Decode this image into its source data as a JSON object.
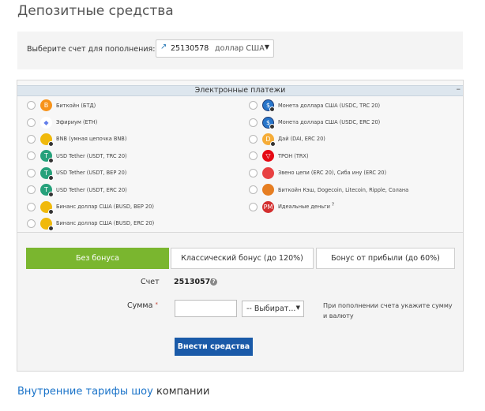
{
  "page": {
    "title": "Депозитные средства"
  },
  "account": {
    "label": "Выберите счет для пополнения:",
    "number": "25130578",
    "currency": "доллар США"
  },
  "payments": {
    "header": "Электронные платежи",
    "left": [
      {
        "label": "Биткойн (БТД)",
        "icon": "bitcoin-icon",
        "color": "#f7931a",
        "glyph": "B"
      },
      {
        "label": "Эфириум (ETH)",
        "icon": "ethereum-icon",
        "color": "#ffffff",
        "glyph": ""
      },
      {
        "label": "BNB (умная цепочка BNB)",
        "icon": "bnb-icon",
        "color": "#f0b90b",
        "glyph": ""
      },
      {
        "label": "USD Tether (USDT, TRC 20)",
        "icon": "tether-icon",
        "color": "#26a17b",
        "glyph": "T"
      },
      {
        "label": "USD Tether (USDT, BEP 20)",
        "icon": "tether-icon",
        "color": "#26a17b",
        "glyph": "T"
      },
      {
        "label": "USD Tether (USDT, ERC 20)",
        "icon": "tether-icon",
        "color": "#26a17b",
        "glyph": "T"
      },
      {
        "label": "Бинанс доллар США (BUSD, BEP 20)",
        "icon": "busd-icon",
        "color": "#f0b90b",
        "glyph": ""
      },
      {
        "label": "Бинанс доллар США (BUSD, ERC 20)",
        "icon": "busd-icon",
        "color": "#f0b90b",
        "glyph": ""
      }
    ],
    "right": [
      {
        "label": "Монета доллара США (USDC, TRC 20)",
        "icon": "usdc-icon",
        "color": "#2775ca",
        "glyph": "$"
      },
      {
        "label": "Монета доллара США (USDC, ERC 20)",
        "icon": "usdc-icon",
        "color": "#2775ca",
        "glyph": "$"
      },
      {
        "label": "Дай (DAI, ERC 20)",
        "icon": "dai-icon",
        "color": "#f5ac37",
        "glyph": "D"
      },
      {
        "label": "ТРОН (TRX)",
        "icon": "tron-icon",
        "color": "#e50914",
        "glyph": "▽"
      },
      {
        "label": "Звено цепи (ERC 20), Сиба ину (ERC 20)",
        "icon": "chainlink-icon",
        "color": "#e84142",
        "glyph": ""
      },
      {
        "label": "Биткойн Кэш, Dogecoin, Litecoin, Ripple, Солана",
        "icon": "altcoins-icon",
        "color": "#e67e22",
        "glyph": ""
      },
      {
        "label": "Идеальные деньги",
        "icon": "perfect-money-icon",
        "color": "#d32f2f",
        "glyph": "PM",
        "sup": "?"
      }
    ]
  },
  "bonus": {
    "options": [
      "Без бонуса",
      "Классический бонус (до 120%)",
      "Бонус от прибыли (до 60%)"
    ]
  },
  "form": {
    "account_label": "Счет",
    "account_value": "25130578",
    "amount_label": "Сумма",
    "amount_required": "*",
    "currency_placeholder": "-- Выбират...",
    "hint": "При пополнении счета укажите сумму и валюту",
    "submit": "Внести средства"
  },
  "footer": {
    "link": "Внутренние тарифы шоу",
    "tail": " компании"
  },
  "colors": {
    "accent_green": "#7ab62f",
    "primary_blue": "#1a5aa8",
    "link_blue": "#1a73c9"
  }
}
